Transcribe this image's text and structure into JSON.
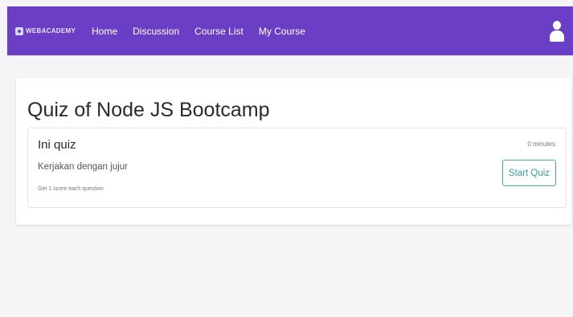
{
  "navbar": {
    "brand_text": "WEBACADEMY",
    "links": [
      "Home",
      "Discussion",
      "Course List",
      "My Course"
    ],
    "bg_color": "#6a3fc5"
  },
  "page": {
    "title": "Quiz of Node JS Bootcamp"
  },
  "quiz": {
    "name": "Ini quiz",
    "description": "Kerjakan dengan jujur",
    "score_info": "Get 1 score each question",
    "duration": "0 minutes",
    "start_button": "Start Quiz"
  }
}
